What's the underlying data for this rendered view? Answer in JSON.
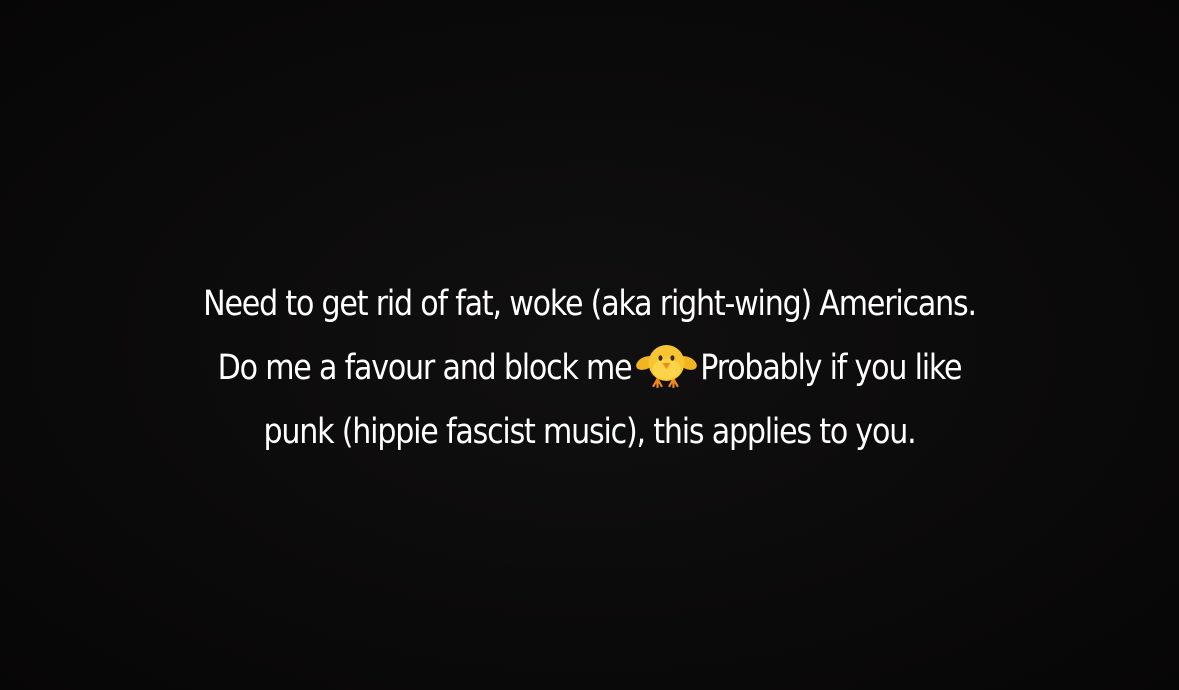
{
  "story": {
    "line1": "Need to get rid of fat, woke (aka right-wing) Americans.",
    "line2_before": "Do me a favour and block me",
    "line2_emoji": "front-facing-baby-chick-emoji",
    "line2_after": "Probably if you like",
    "line3": "punk (hippie fascist music), this applies to you."
  },
  "colors": {
    "background": "#0b0a0a",
    "text": "#ffffff",
    "chick_body": "#f7c531",
    "chick_beak": "#f08a1c"
  }
}
